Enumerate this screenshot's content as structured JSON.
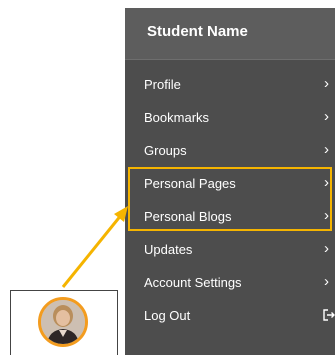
{
  "menu": {
    "header": "Student Name",
    "items": [
      {
        "label": "Profile",
        "icon": "chevron-right-icon"
      },
      {
        "label": "Bookmarks",
        "icon": "chevron-right-icon"
      },
      {
        "label": "Groups",
        "icon": "chevron-right-icon"
      },
      {
        "label": "Personal Pages",
        "icon": "chevron-right-icon"
      },
      {
        "label": "Personal Blogs",
        "icon": "chevron-right-icon"
      },
      {
        "label": "Updates",
        "icon": "chevron-right-icon"
      },
      {
        "label": "Account Settings",
        "icon": "chevron-right-icon"
      },
      {
        "label": "Log Out",
        "icon": "logout-icon"
      }
    ]
  },
  "colors": {
    "menu_background": "#4d4d4d",
    "header_background": "#5d5d5d",
    "highlight": "#f5b400",
    "avatar_ring": "#f39c1f"
  }
}
